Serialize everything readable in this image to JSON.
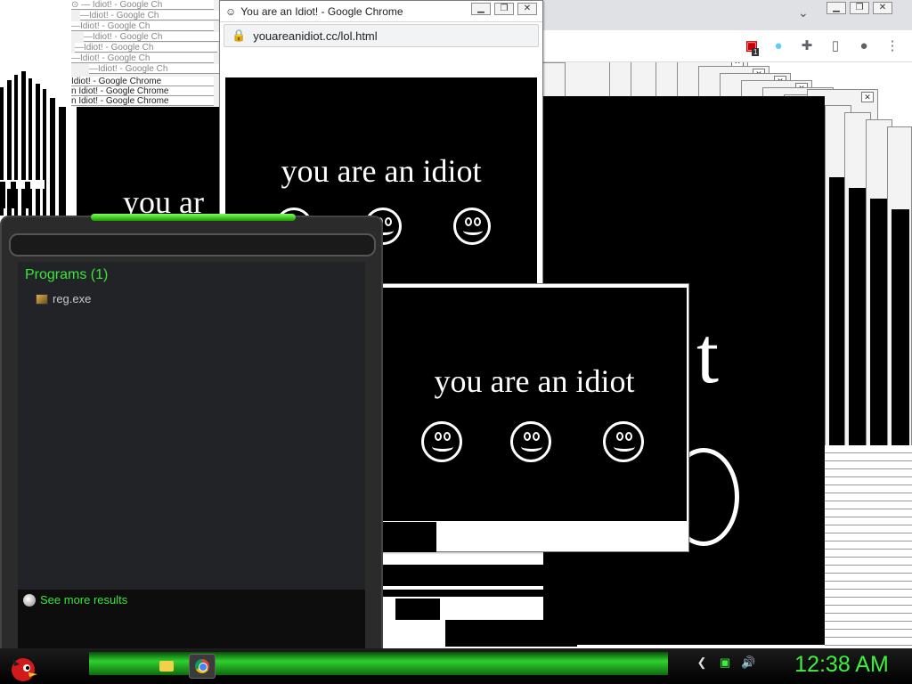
{
  "popup": {
    "title": "You are an Idiot! - Google Chrome",
    "url": "youareanidiot.cc/lol.html",
    "message": "you are an idiot",
    "partial_message": "you ar",
    "big_letter": "t"
  },
  "background_titles": [
    "Idiot! - Google Chrome",
    "n Idiot! - Google Chrome",
    "n Idiot! - Google Chrome"
  ],
  "window_controls": {
    "minimize": "▁",
    "maximize": "❐",
    "close": "✕"
  },
  "chrome_toolbar": {
    "icons": [
      "extension-badge-icon",
      "profile-flag-icon",
      "puzzle-icon",
      "sidepanel-icon",
      "account-icon",
      "kebab-menu-icon"
    ],
    "badge_count": "1"
  },
  "start_menu": {
    "section_title": "Programs (1)",
    "result": "reg.exe",
    "see_more": "See more results"
  },
  "taskbar": {
    "clock": "12:38 AM",
    "pinned": [
      "folder-icon",
      "chrome-icon"
    ]
  },
  "colors": {
    "accent_green": "#39e639",
    "clock_green": "#3df03d",
    "popup_black": "#000000"
  }
}
